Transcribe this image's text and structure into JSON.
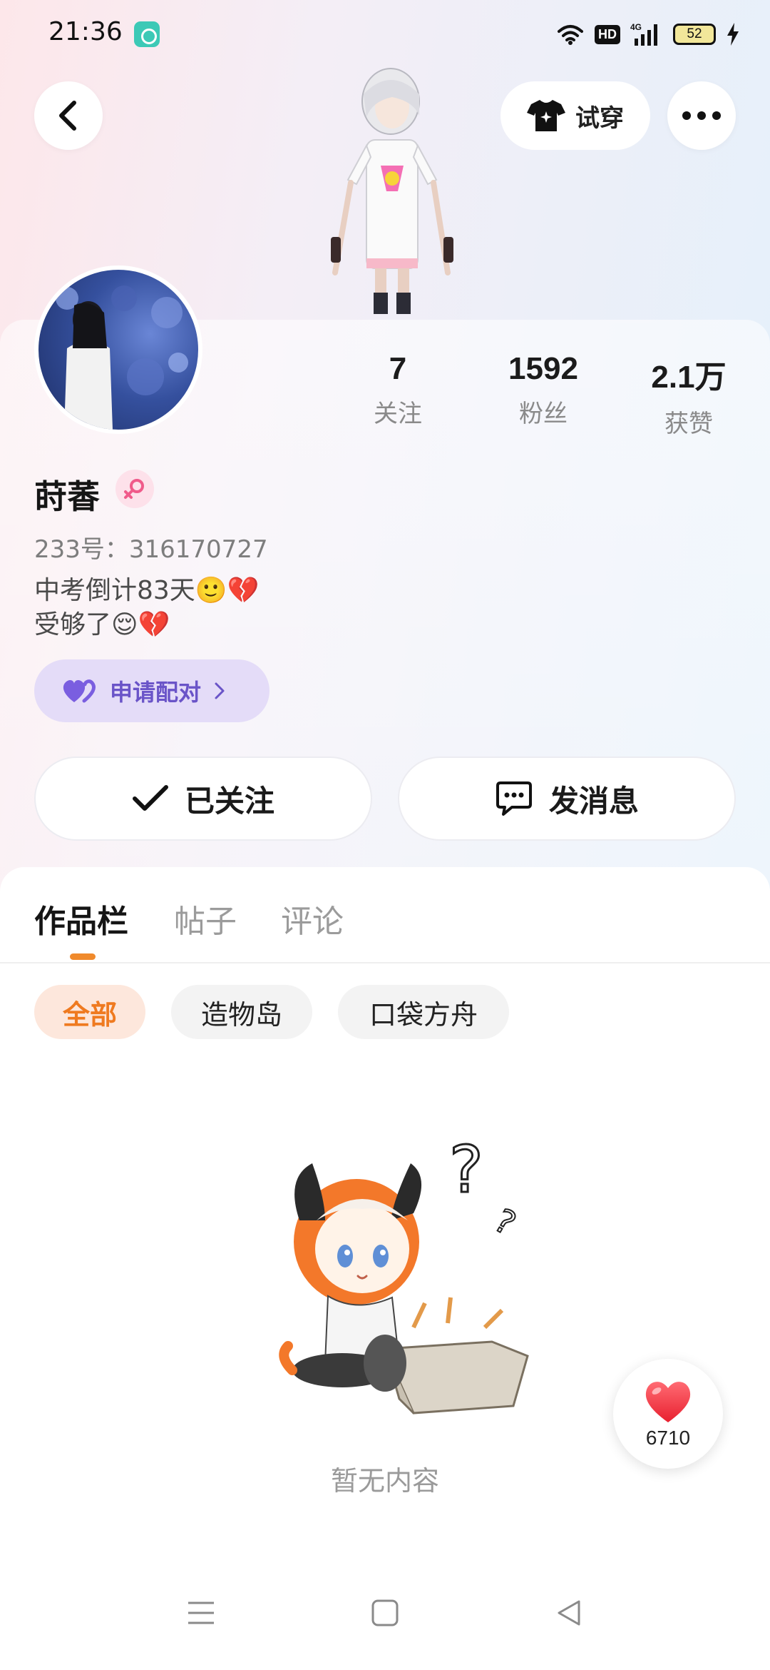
{
  "status_bar": {
    "time": "21:36",
    "network": "4G",
    "hd": "HD",
    "battery": "52"
  },
  "header": {
    "try_on_label": "试穿"
  },
  "stats": [
    {
      "value": "7",
      "label": "关注"
    },
    {
      "value": "1592",
      "label": "粉丝"
    },
    {
      "value": "2.1万",
      "label": "获赞"
    }
  ],
  "profile": {
    "username": "莳萫",
    "user_id": "233号：316170727",
    "bio_line1": "中考倒计83天🙂💔",
    "bio_line2": "受够了😌💔",
    "pair_label": "申请配对"
  },
  "actions": {
    "follow_label": "已关注",
    "message_label": "发消息"
  },
  "tabs": [
    {
      "label": "作品栏",
      "active": true
    },
    {
      "label": "帖子",
      "active": false
    },
    {
      "label": "评论",
      "active": false
    }
  ],
  "filters": [
    {
      "label": "全部",
      "active": true
    },
    {
      "label": "造物岛",
      "active": false
    },
    {
      "label": "口袋方舟",
      "active": false
    }
  ],
  "empty_state": {
    "text": "暂无内容"
  },
  "like_float": {
    "count": "6710"
  },
  "colors": {
    "accent_orange": "#ef7a20",
    "pair_purple": "#6a54c8",
    "heart_red": "#f23a4a"
  }
}
